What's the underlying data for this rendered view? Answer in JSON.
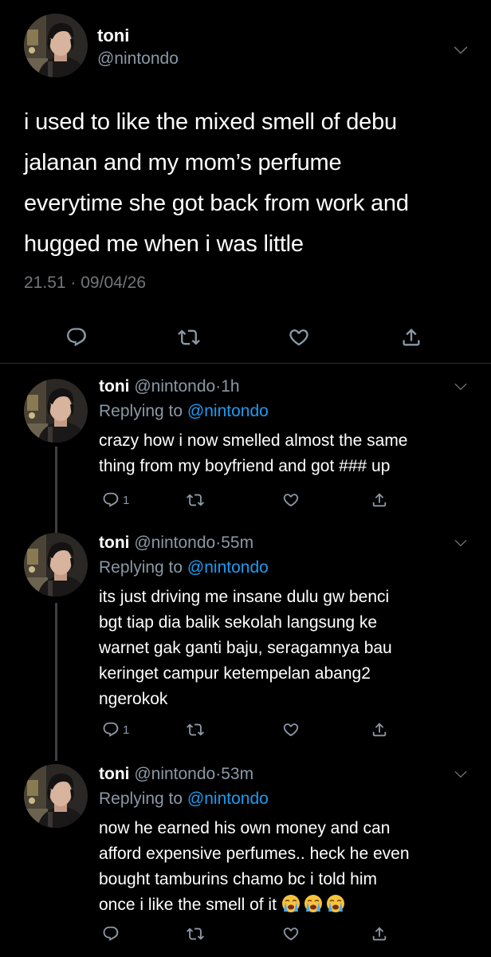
{
  "main": {
    "name": "toni",
    "handle": "@nintondo",
    "text_lines": [
      "i used to like the mixed smell of debu",
      "jalanan and my mom’s perfume",
      "everytime she got back from work and",
      "hugged me when i was little"
    ],
    "time": "21.51",
    "date": "09/04/26",
    "meta_sep": "·"
  },
  "replies": [
    {
      "name": "toni",
      "handle": "@nintondo",
      "dot": "·",
      "time": "1h",
      "replying_prefix": "Replying to ",
      "replying_to": "@nintondo",
      "text_lines": [
        "crazy how i now smelled almost the same",
        "thing from my boyfriend and got ### up"
      ],
      "reply_count": "1"
    },
    {
      "name": "toni",
      "handle": "@nintondo",
      "dot": "·",
      "time": "55m",
      "replying_prefix": "Replying to ",
      "replying_to": "@nintondo",
      "text_lines": [
        "its just driving me insane dulu gw benci",
        "bgt tiap dia balik sekolah langsung ke",
        "warnet gak ganti baju, seragamnya bau",
        "keringet campur ketempelan abang2",
        "ngerokok"
      ],
      "reply_count": "1"
    },
    {
      "name": "toni",
      "handle": "@nintondo",
      "dot": "·",
      "time": "53m",
      "replying_prefix": "Replying to ",
      "replying_to": "@nintondo",
      "text_lines": [
        "now he earned his own money and can",
        "afford expensive perfumes.. heck he even",
        "bought tamburins chamo bc i told him",
        "once i like the smell of it"
      ],
      "emojis": [
        "loudly-crying-face",
        "loudly-crying-face",
        "loudly-crying-face"
      ],
      "reply_count": ""
    }
  ],
  "icons": {
    "reply": "reply-icon",
    "retweet": "retweet-icon",
    "like": "heart-icon",
    "share": "share-icon",
    "more": "chevron-down-icon"
  },
  "colors": {
    "background": "#000000",
    "text": "#ffffff",
    "secondary": "#8b98a5",
    "link": "#1d9bf0",
    "divider": "#2f3336"
  }
}
